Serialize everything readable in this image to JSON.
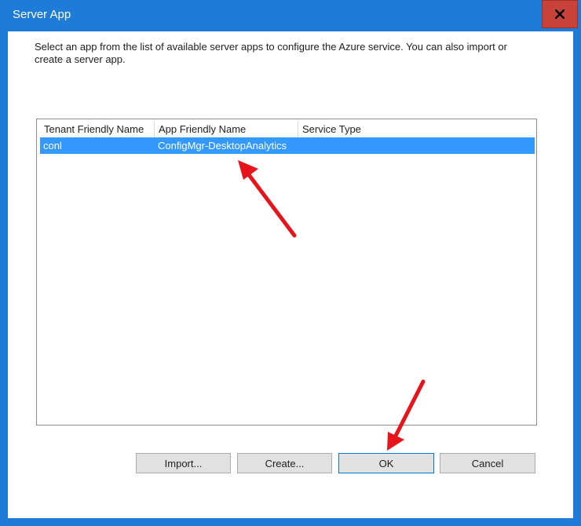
{
  "window": {
    "title": "Server App"
  },
  "instructions": "Select an app from the list of available server apps to configure the Azure service. You can also import or create a server app.",
  "table": {
    "columns": [
      "Tenant Friendly Name",
      "App Friendly Name",
      "Service Type"
    ],
    "rows": [
      {
        "tenant": "conl",
        "app": "ConfigMgr-DesktopAnalytics",
        "service": ""
      }
    ]
  },
  "buttons": {
    "import": "Import...",
    "create": "Create...",
    "ok": "OK",
    "cancel": "Cancel"
  },
  "colors": {
    "titlebar": "#1f7bd8",
    "close": "#c9423a",
    "selection": "#3399ff",
    "annotation_arrow": "#e8141c"
  }
}
